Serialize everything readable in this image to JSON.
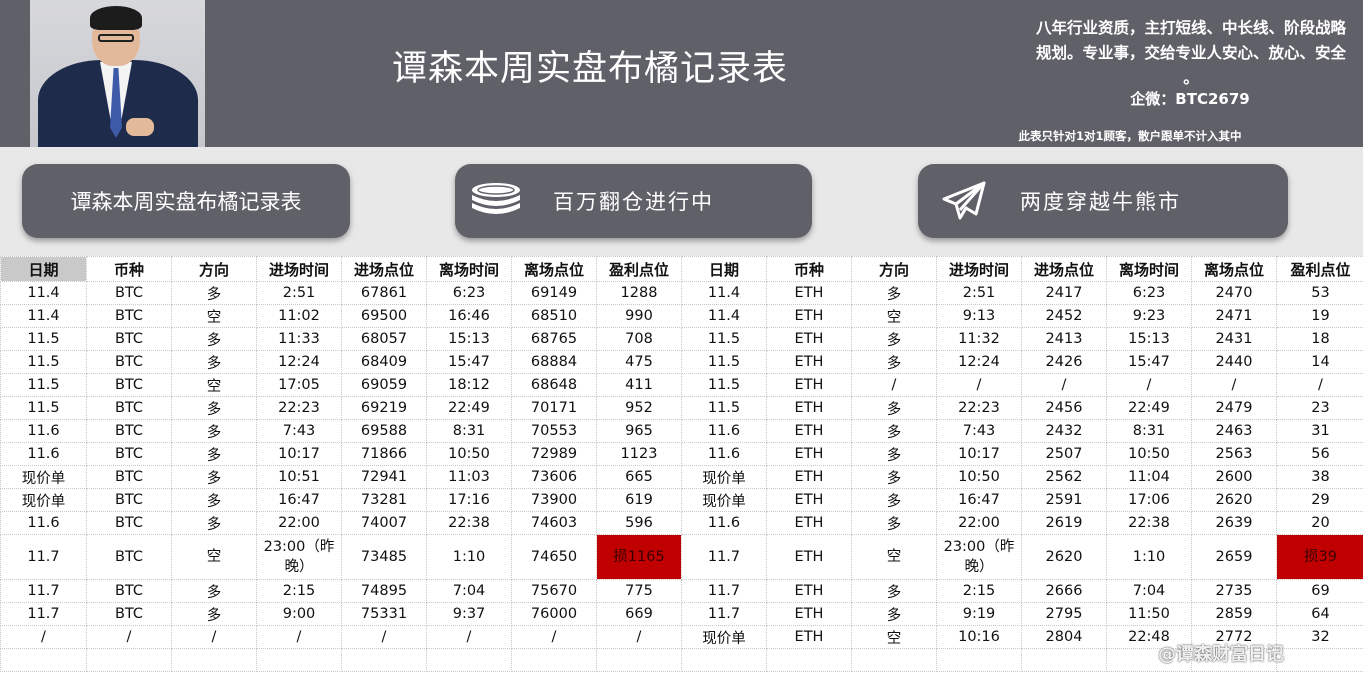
{
  "header": {
    "title": "谭森本周实盘布橘记录表",
    "slogan_line1": "八年行业资质，主打短线、中长线、阶段战略",
    "slogan_line2": "规划。专业事，交给专业人安心、放心、安全",
    "slogan_line3": "。",
    "wechat": "企微：BTC2679",
    "notice": "此表只针对1对1顾客，散户跟单不计入其中"
  },
  "banners": [
    {
      "label": "谭森本周实盘布橘记录表",
      "icon": "none"
    },
    {
      "label": "百万翻仓进行中",
      "icon": "coin-stack-icon"
    },
    {
      "label": "两度穿越牛熊市",
      "icon": "paper-plane-icon"
    }
  ],
  "table": {
    "headers": [
      "日期",
      "币种",
      "方向",
      "进场时间",
      "进场点位",
      "离场时间",
      "离场点位",
      "盈利点位",
      "日期",
      "币种",
      "方向",
      "进场时间",
      "进场点位",
      "离场时间",
      "离场点位",
      "盈利点位"
    ],
    "rows": [
      [
        "11.4",
        "BTC",
        "多",
        "2:51",
        "67861",
        "6:23",
        "69149",
        "1288",
        "11.4",
        "ETH",
        "多",
        "2:51",
        "2417",
        "6:23",
        "2470",
        "53"
      ],
      [
        "11.4",
        "BTC",
        "空",
        "11:02",
        "69500",
        "16:46",
        "68510",
        "990",
        "11.4",
        "ETH",
        "空",
        "9:13",
        "2452",
        "9:23",
        "2471",
        "19"
      ],
      [
        "11.5",
        "BTC",
        "多",
        "11:33",
        "68057",
        "15:13",
        "68765",
        "708",
        "11.5",
        "ETH",
        "多",
        "11:32",
        "2413",
        "15:13",
        "2431",
        "18"
      ],
      [
        "11.5",
        "BTC",
        "多",
        "12:24",
        "68409",
        "15:47",
        "68884",
        "475",
        "11.5",
        "ETH",
        "多",
        "12:24",
        "2426",
        "15:47",
        "2440",
        "14"
      ],
      [
        "11.5",
        "BTC",
        "空",
        "17:05",
        "69059",
        "18:12",
        "68648",
        "411",
        "11.5",
        "ETH",
        "/",
        "/",
        "/",
        "/",
        "/",
        "/"
      ],
      [
        "11.5",
        "BTC",
        "多",
        "22:23",
        "69219",
        "22:49",
        "70171",
        "952",
        "11.5",
        "ETH",
        "多",
        "22:23",
        "2456",
        "22:49",
        "2479",
        "23"
      ],
      [
        "11.6",
        "BTC",
        "多",
        "7:43",
        "69588",
        "8:31",
        "70553",
        "965",
        "11.6",
        "ETH",
        "多",
        "7:43",
        "2432",
        "8:31",
        "2463",
        "31"
      ],
      [
        "11.6",
        "BTC",
        "多",
        "10:17",
        "71866",
        "10:50",
        "72989",
        "1123",
        "11.6",
        "ETH",
        "多",
        "10:17",
        "2507",
        "10:50",
        "2563",
        "56"
      ],
      [
        "现价单",
        "BTC",
        "多",
        "10:51",
        "72941",
        "11:03",
        "73606",
        "665",
        "现价单",
        "ETH",
        "多",
        "10:50",
        "2562",
        "11:04",
        "2600",
        "38"
      ],
      [
        "现价单",
        "BTC",
        "多",
        "16:47",
        "73281",
        "17:16",
        "73900",
        "619",
        "现价单",
        "ETH",
        "多",
        "16:47",
        "2591",
        "17:06",
        "2620",
        "29"
      ],
      [
        "11.6",
        "BTC",
        "多",
        "22:00",
        "74007",
        "22:38",
        "74603",
        "596",
        "11.6",
        "ETH",
        "多",
        "22:00",
        "2619",
        "22:38",
        "2639",
        "20"
      ],
      [
        "11.7",
        "BTC",
        "空",
        "23:00（昨晚）",
        "73485",
        "1:10",
        "74650",
        "损1165",
        "11.7",
        "ETH",
        "空",
        "23:00（昨晚）",
        "2620",
        "1:10",
        "2659",
        "损39"
      ],
      [
        "11.7",
        "BTC",
        "多",
        "2:15",
        "74895",
        "7:04",
        "75670",
        "775",
        "11.7",
        "ETH",
        "多",
        "2:15",
        "2666",
        "7:04",
        "2735",
        "69"
      ],
      [
        "11.7",
        "BTC",
        "多",
        "9:00",
        "75331",
        "9:37",
        "76000",
        "669",
        "11.7",
        "ETH",
        "多",
        "9:19",
        "2795",
        "11:50",
        "2859",
        "64"
      ],
      [
        "/",
        "/",
        "/",
        "/",
        "/",
        "/",
        "/",
        "/",
        "现价单",
        "ETH",
        "空",
        "10:16",
        "2804",
        "22:48",
        "2772",
        "32"
      ]
    ]
  },
  "colors": {
    "header_bg": "#5f6068",
    "loss_bg": "#c00000",
    "date_header_bg": "#c9c9c9"
  },
  "watermark": "@谭森财富日记"
}
